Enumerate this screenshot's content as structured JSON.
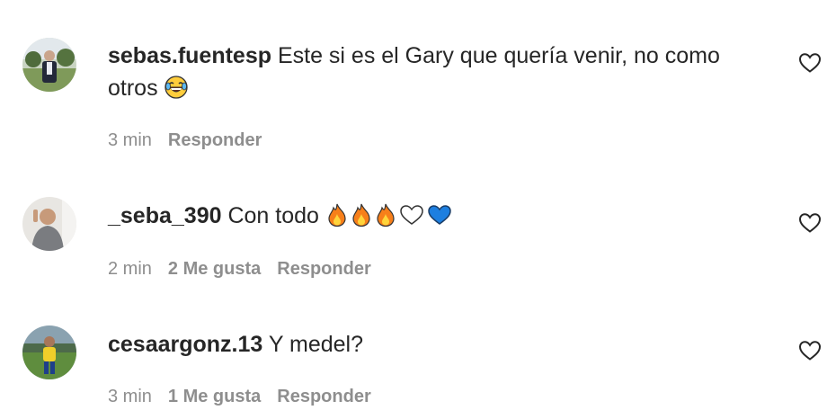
{
  "comments": [
    {
      "username": "sebas.fuentesp",
      "text": " Este si es el Gary que quería venir, no como otros",
      "time": "3 min",
      "likes": "",
      "reply_label": "Responder"
    },
    {
      "username": "_seba_390",
      "text": " Con todo",
      "time": "2 min",
      "likes": "2 Me gusta",
      "reply_label": "Responder"
    },
    {
      "username": "cesaargonz.13",
      "text": " Y medel?",
      "time": "3 min",
      "likes": "1 Me gusta",
      "reply_label": "Responder"
    }
  ],
  "icons": {
    "like": "heart-outline-icon",
    "emoji_laugh": "face-with-tears-of-joy",
    "emoji_fire": "fire",
    "emoji_white_heart": "white-heart",
    "emoji_blue_heart": "blue-heart"
  },
  "colors": {
    "text": "#262626",
    "meta": "#8e8e8e",
    "blue_heart": "#1d7fe0",
    "fire": "#f77f1a"
  }
}
